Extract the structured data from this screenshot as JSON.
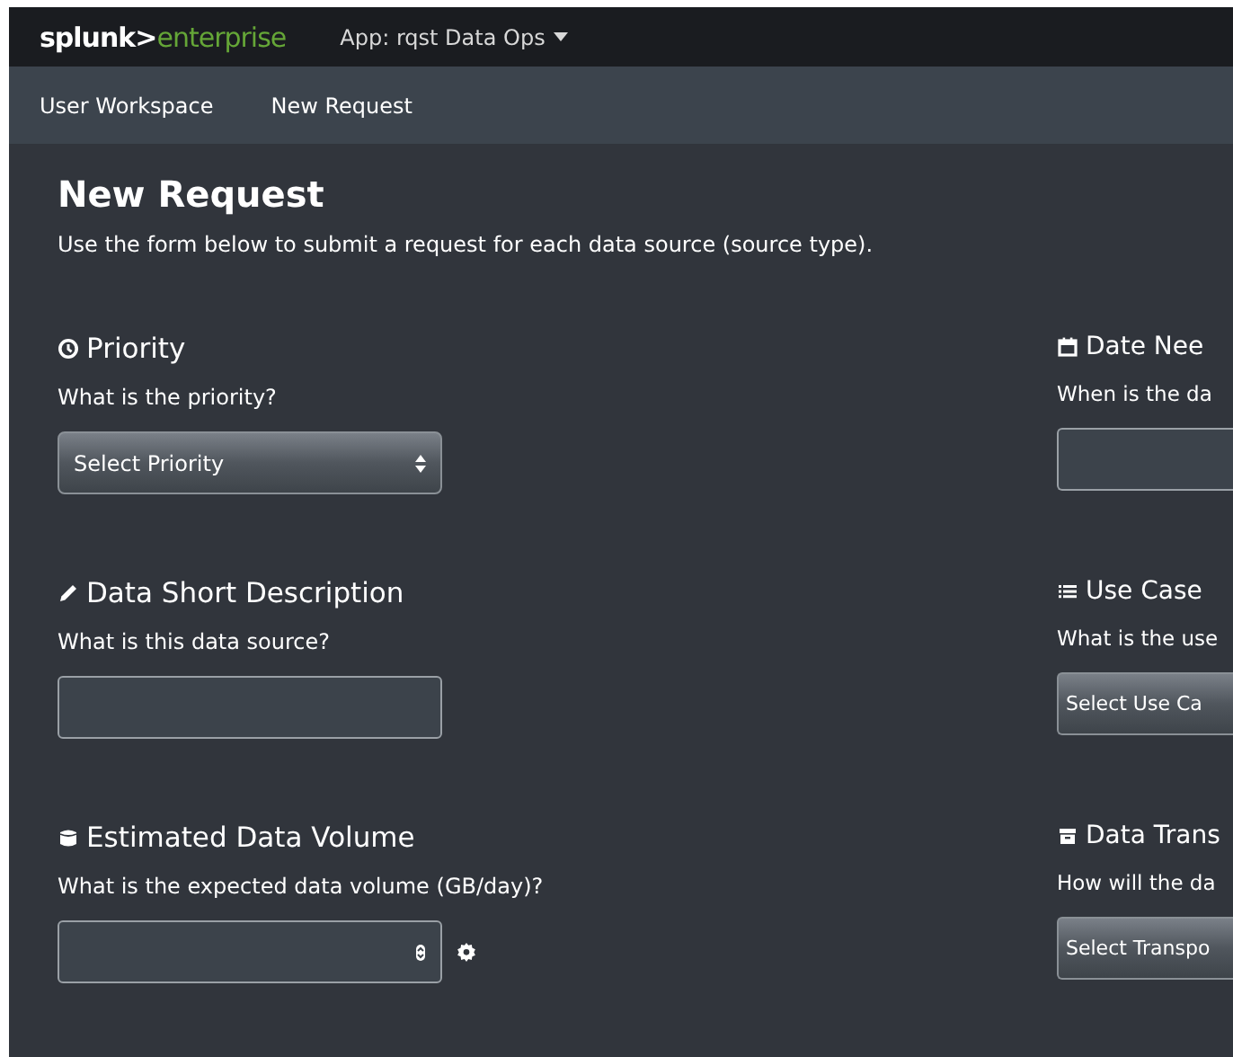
{
  "header": {
    "logo_left": "splunk>",
    "logo_right": "enterprise",
    "app_menu": "App: rqst Data Ops"
  },
  "nav": [
    {
      "label": "User Workspace"
    },
    {
      "label": "New Request"
    }
  ],
  "page": {
    "title": "New Request",
    "description": "Use the form below to submit a request for each data source (source type)."
  },
  "fields": [
    {
      "label": "Priority",
      "question": "What is the priority?",
      "kind": "select",
      "value": "Select Priority"
    },
    {
      "label": "Date Nee",
      "question": "When is the da",
      "kind": "text"
    },
    {
      "label": "Data Short Description",
      "question": "What is this data source?",
      "kind": "text"
    },
    {
      "label": "Use Case",
      "question": "What is the use",
      "kind": "select",
      "value": "Select Use Ca"
    },
    {
      "label": "Estimated Data Volume",
      "question": "What is the expected data volume (GB/day)?",
      "kind": "number"
    },
    {
      "label": "Data Trans",
      "question": "How will the da",
      "kind": "select",
      "value": "Select Transpo"
    }
  ]
}
